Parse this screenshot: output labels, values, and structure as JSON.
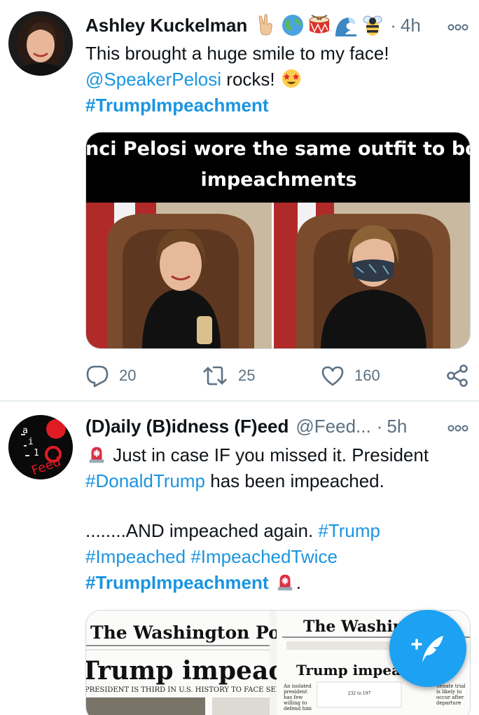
{
  "tweets": [
    {
      "author_name": "Ashley Kuckelman",
      "name_emojis": [
        "victory-hand-icon",
        "globe-icon",
        "drum-icon",
        "wave-icon",
        "bee-icon"
      ],
      "time": "4h",
      "text_line1": "This brought a huge smile to my face!",
      "mention": "@SpeakerPelosi",
      "after_mention": " rocks! ",
      "hashtag": "#TrumpImpeachment",
      "image_caption_line1": "Nanci Pelosi wore the same outfit to both",
      "image_caption_line2": "impeachments",
      "stats": {
        "replies": "20",
        "retweets": "25",
        "likes": "160"
      }
    },
    {
      "author_name": "(D)aily (B)idness (F)eed",
      "handle": "@Feed...",
      "time": "5h",
      "line1": " Just in case IF you missed it. President",
      "tag_donald": "#DonaldTrump",
      "line2_after": " has been impeached.",
      "line3": "........AND impeached again. ",
      "tag_trump": "#Trump",
      "tag_impeached": "#Impeached",
      "tag_twice": "#ImpeachedTwice",
      "tag_bold": "#TrumpImpeachment",
      "end_punct": ".",
      "newspaper1_masthead": "The Washington Post",
      "newspaper1_headline": "Trump impeached",
      "newspaper1_sub": "PRESIDENT IS THIRD IN U.S. HISTORY TO FACE SENATE TRIAL",
      "newspaper2_masthead": "The Washington",
      "newspaper2_headline": "Trump impeached",
      "newspaper2_side_left": "An isolated president has few willing to defend him",
      "newspaper2_side_right": "Senate trial is likely to occur after departure",
      "newspaper2_tally": "232 to 197"
    }
  ],
  "colors": {
    "link": "#1b95e0",
    "secondary": "#5b7083",
    "fab": "#1da1f2",
    "divider": "#e6ecf0"
  },
  "fab_icon": "compose-tweet-icon"
}
